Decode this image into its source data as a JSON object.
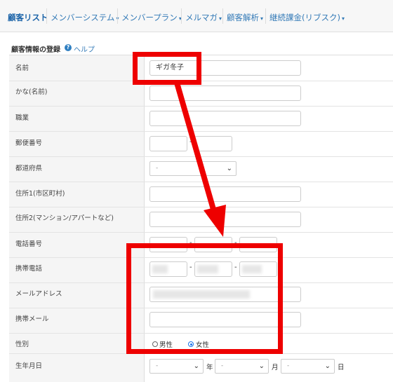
{
  "nav": {
    "items": [
      {
        "label": "顧客リスト",
        "has_caret": false,
        "active": true
      },
      {
        "label": "メンバーシステム",
        "has_caret": true
      },
      {
        "label": "メンバープラン",
        "has_caret": true
      },
      {
        "label": "メルマガ",
        "has_caret": true
      },
      {
        "label": "顧客解析",
        "has_caret": true
      },
      {
        "label": "継続課金(リブスク)",
        "has_caret": true
      }
    ],
    "caret_glyph": "▾"
  },
  "section": {
    "title": "顧客情報の登録",
    "help_icon": "question-circle-icon",
    "help_label": "ヘルプ"
  },
  "form": {
    "labels": {
      "name": "名前",
      "kana": "かな(名前)",
      "occupation": "職業",
      "postal": "郵便番号",
      "prefecture": "都道府県",
      "address1": "住所1(市区町村)",
      "address2": "住所2(マンション/アパートなど)",
      "phone": "電話番号",
      "mobile": "携帯電話",
      "email": "メールアドレス",
      "mobile_email": "携帯メール",
      "gender": "性別",
      "birthday": "生年月日"
    },
    "values": {
      "name": "ギガ冬子",
      "postal_separator": "-",
      "prefecture_selected": "-",
      "phone_separator": "-",
      "mobile_separator": "-",
      "birth_year_selected": "-",
      "birth_month_selected": "-",
      "birth_day_selected": "-"
    },
    "gender": {
      "options": [
        "男性",
        "女性"
      ],
      "selected": "女性"
    },
    "birthday_units": {
      "year": "年",
      "month": "月",
      "day": "日"
    }
  },
  "annotation": {
    "color": "#ee0000"
  }
}
